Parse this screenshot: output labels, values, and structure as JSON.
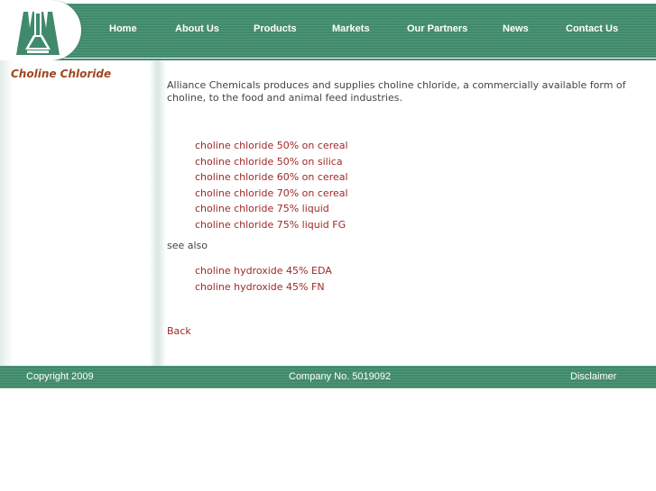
{
  "nav": {
    "items": [
      {
        "label": "Home"
      },
      {
        "label": "About Us"
      },
      {
        "label": "Products"
      },
      {
        "label": "Markets"
      },
      {
        "label": "Our Partners"
      },
      {
        "label": "News"
      },
      {
        "label": "Contact Us"
      }
    ]
  },
  "sidebar": {
    "title": "Choline Chloride"
  },
  "main": {
    "intro": "Alliance Chemicals produces and supplies choline chloride, a commercially available form of choline, to the food and animal feed industries.",
    "products": [
      "choline chloride 50% on cereal",
      "choline chloride 50% on silica",
      "choline chloride 60% on cereal",
      "choline chloride 70% on cereal",
      "choline chloride 75% liquid",
      "choline chloride 75% liquid FG"
    ],
    "see_also_label": "see also",
    "related": [
      "choline hydroxide 45% EDA",
      "choline hydroxide 45% FN"
    ],
    "back_label": "Back"
  },
  "footer": {
    "copyright": "Copyright 2009",
    "company_no": "Company No. 5019092",
    "disclaimer": "Disclaimer"
  },
  "colors": {
    "brand_green": "#3f8a6b",
    "link_red": "#a02828",
    "title_brown": "#a0461e"
  },
  "logo": {
    "icon": "flask-tower-icon"
  }
}
